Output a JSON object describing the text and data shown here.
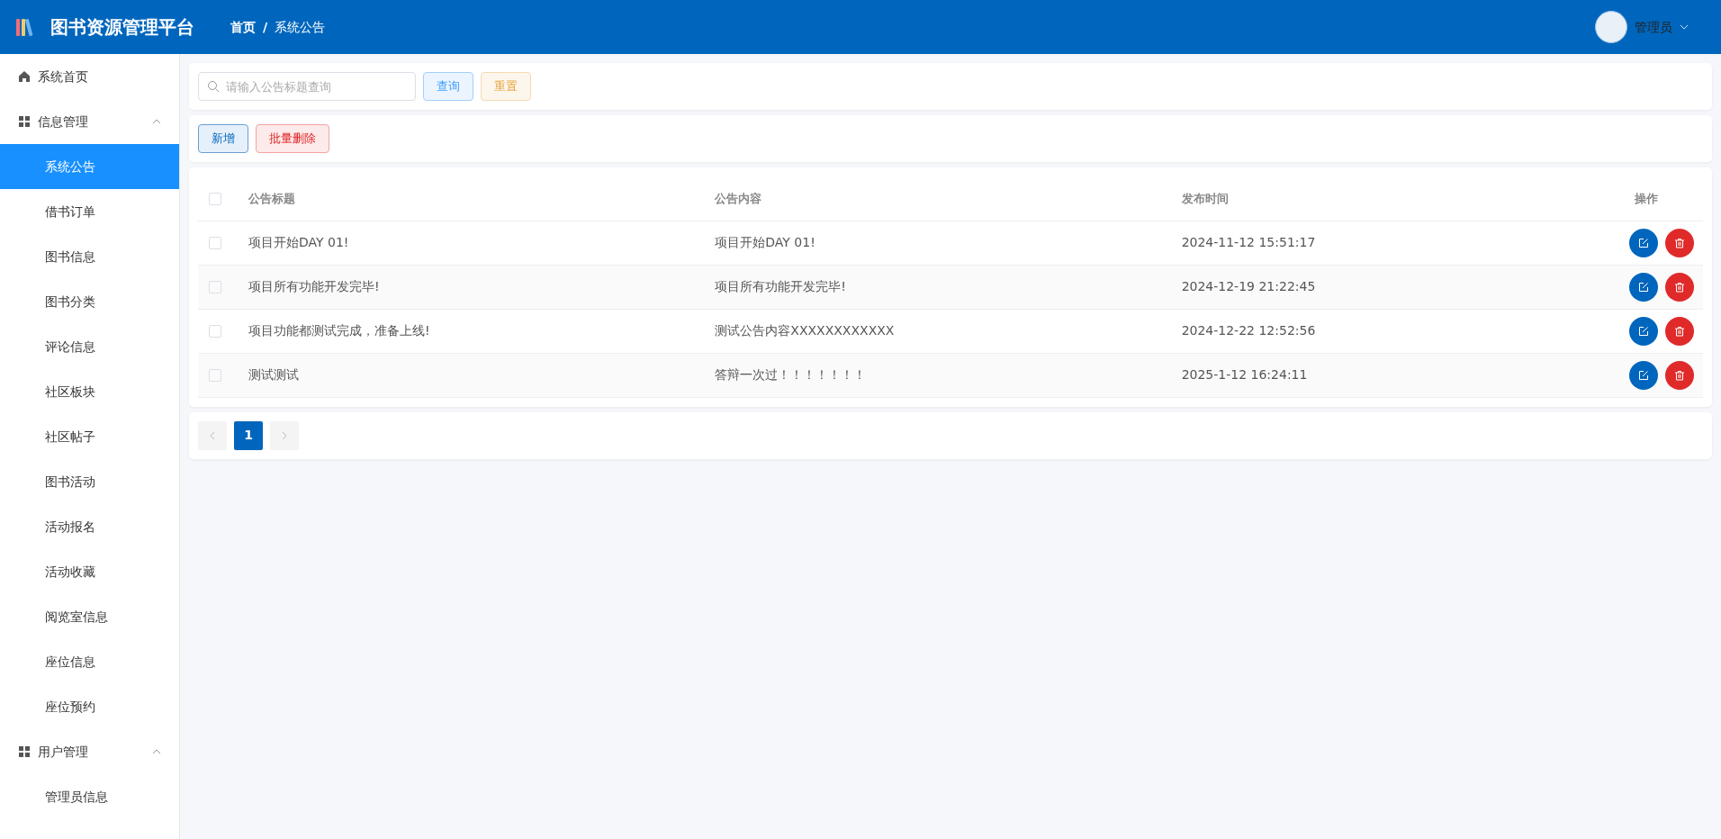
{
  "header": {
    "title": "图书资源管理平台",
    "breadcrumb": [
      "首页",
      "系统公告"
    ],
    "separator": "/",
    "user": {
      "name": "管理员"
    }
  },
  "sidebar": {
    "items": [
      {
        "kind": "link",
        "label": "系统首页",
        "selected": false
      },
      {
        "kind": "group",
        "label": "信息管理",
        "expanded": true,
        "children": [
          {
            "label": "系统公告",
            "selected": true
          },
          {
            "label": "借书订单",
            "selected": false
          },
          {
            "label": "图书信息",
            "selected": false
          },
          {
            "label": "图书分类",
            "selected": false
          },
          {
            "label": "评论信息",
            "selected": false
          },
          {
            "label": "社区板块",
            "selected": false
          },
          {
            "label": "社区帖子",
            "selected": false
          },
          {
            "label": "图书活动",
            "selected": false
          },
          {
            "label": "活动报名",
            "selected": false
          },
          {
            "label": "活动收藏",
            "selected": false
          },
          {
            "label": "阅览室信息",
            "selected": false
          },
          {
            "label": "座位信息",
            "selected": false
          },
          {
            "label": "座位预约",
            "selected": false
          }
        ]
      },
      {
        "kind": "group",
        "label": "用户管理",
        "expanded": true,
        "children": [
          {
            "label": "管理员信息",
            "selected": false
          }
        ]
      }
    ]
  },
  "search": {
    "placeholder": "请输入公告标题查询",
    "buttons": [
      {
        "kind": "info",
        "label": "查询"
      },
      {
        "kind": "warning",
        "label": "重置"
      }
    ]
  },
  "actions": [
    {
      "kind": "primary",
      "label": "新增"
    },
    {
      "kind": "danger",
      "label": "批量删除"
    }
  ],
  "table": {
    "select_all": {
      "checked": false
    },
    "columns": [
      "公告标题",
      "公告内容",
      "发布时间",
      "操作"
    ],
    "rows": [
      {
        "checked": false,
        "title": "项目开始DAY 01!",
        "content": "项目开始DAY 01!",
        "time": "2024-11-12 15:51:17"
      },
      {
        "checked": false,
        "title": "项目所有功能开发完毕!",
        "content": "项目所有功能开发完毕!",
        "time": "2024-12-19 21:22:45"
      },
      {
        "checked": false,
        "title": "项目功能都测试完成，准备上线!",
        "content": "测试公告内容XXXXXXXXXXXX",
        "time": "2024-12-22 12:52:56"
      },
      {
        "checked": false,
        "title": "测试测试",
        "content": "答辩一次过！！！！！！！",
        "time": "2025-1-12 16:24:11"
      }
    ]
  },
  "pagination": {
    "pages": [
      {
        "label": "1",
        "selected": true
      }
    ]
  }
}
